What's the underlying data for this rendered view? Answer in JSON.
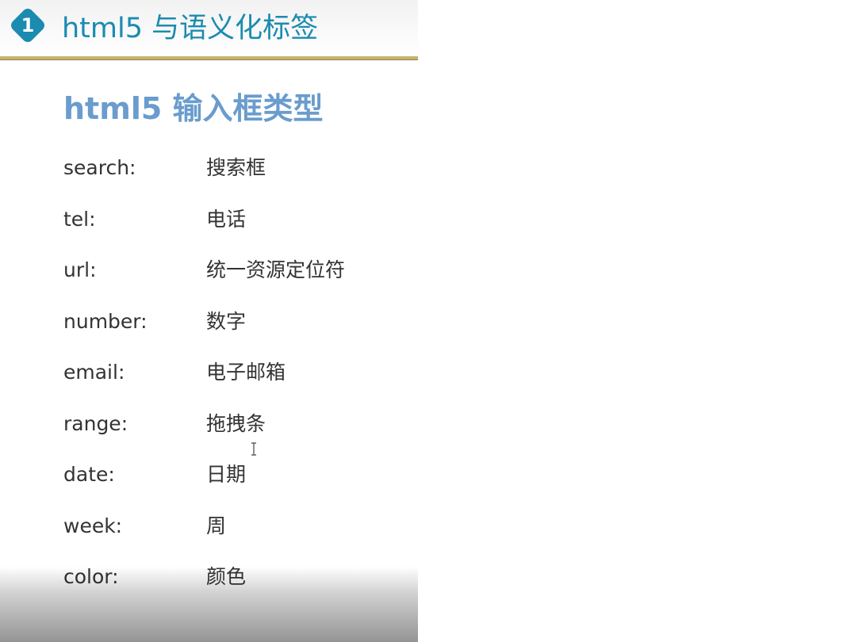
{
  "header": {
    "badge_number": "1",
    "title": "html5 与语义化标签"
  },
  "section": {
    "title": "html5 输入框类型"
  },
  "rows": [
    {
      "term": "search:",
      "desc": "搜索框"
    },
    {
      "term": "tel:",
      "desc": "电话"
    },
    {
      "term": "url:",
      "desc": "统一资源定位符"
    },
    {
      "term": "number:",
      "desc": "数字"
    },
    {
      "term": "email:",
      "desc": "电子邮箱"
    },
    {
      "term": "range:",
      "desc": "拖拽条"
    },
    {
      "term": "date:",
      "desc": "日期"
    },
    {
      "term": "week:",
      "desc": "周"
    },
    {
      "term": "color:",
      "desc": "颜色"
    }
  ],
  "colors": {
    "accent": "#1b8bb0",
    "section_title": "#6a9ccd",
    "rule": "#c7b36a"
  },
  "icons": {
    "badge": "diamond-number-icon",
    "cursor": "text-cursor-icon"
  }
}
